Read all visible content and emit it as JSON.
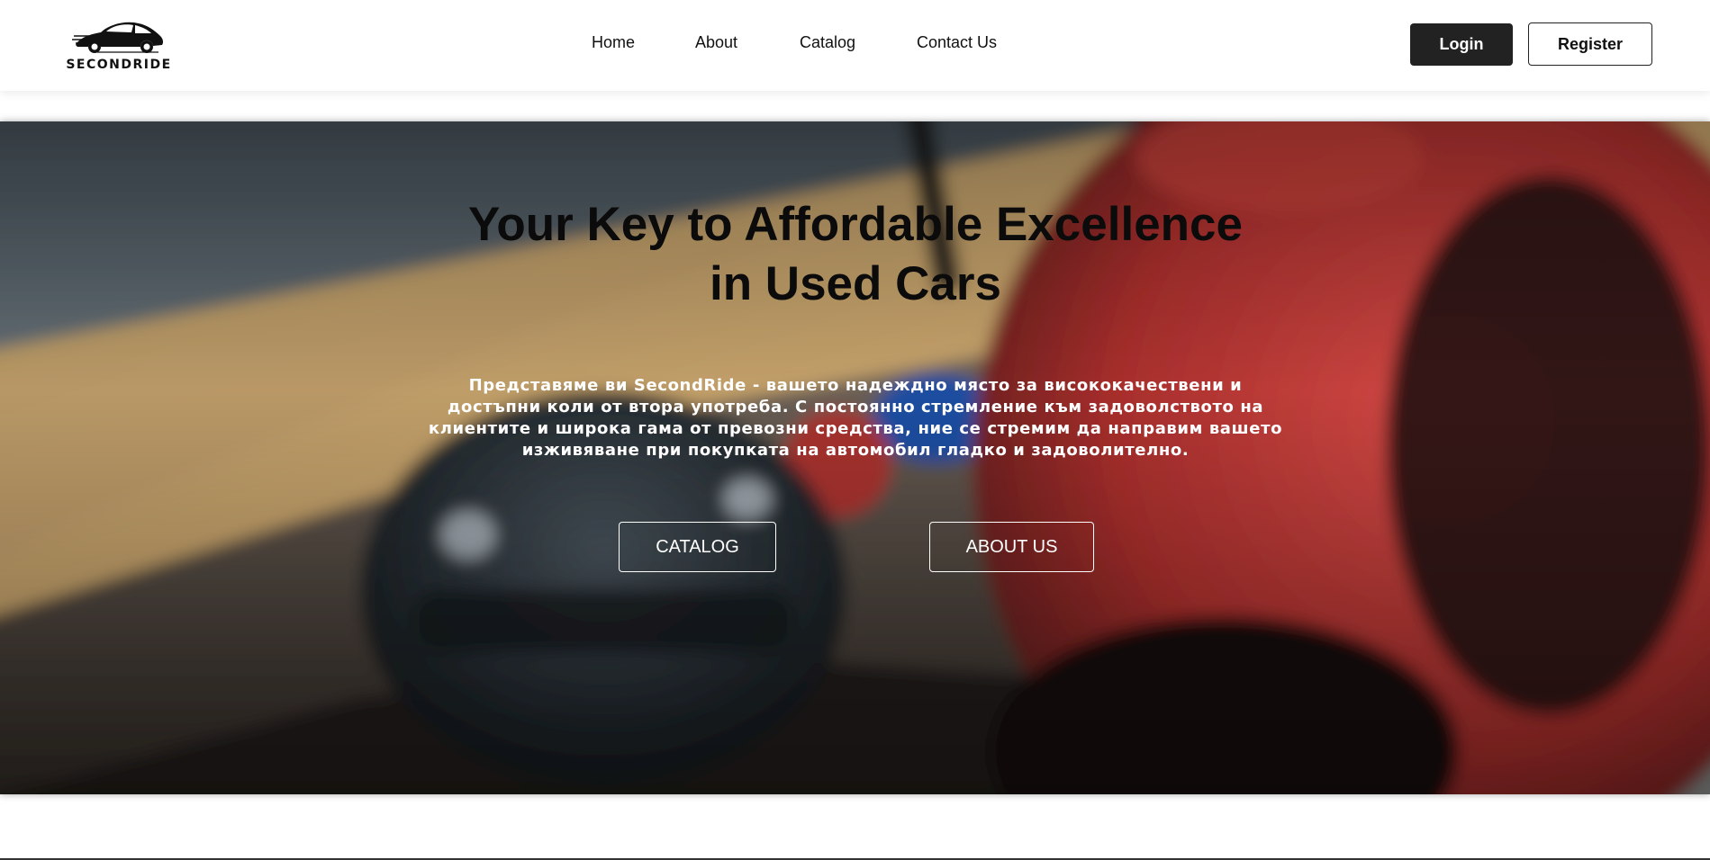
{
  "brand": {
    "name": "SECONDRIDE",
    "logo_icon": "sports-car-icon"
  },
  "nav": {
    "items": [
      {
        "label": "Home"
      },
      {
        "label": "About"
      },
      {
        "label": "Catalog"
      },
      {
        "label": "Contact Us"
      }
    ]
  },
  "auth": {
    "login_label": "Login",
    "register_label": "Register"
  },
  "hero": {
    "title_line1": "Your Key to Affordable Excellence",
    "title_line2": "in Used Cars",
    "description": "Представяме ви SecondRide - вашето надеждно място за висококачествени и достъпни коли от втора употреба. С постоянно стремление към задоволството на клиентите и широка гама от превозни средства, ние се стремим да направим вашето изживяване при покупката на автомобил гладко и задоволително.",
    "catalog_button": "CATALOG",
    "about_button": "ABOUT US",
    "background_icon": "racing-cars-background-image"
  },
  "colors": {
    "primary_dark": "#222222",
    "text_dark": "#111111",
    "text_light": "#ffffff"
  }
}
